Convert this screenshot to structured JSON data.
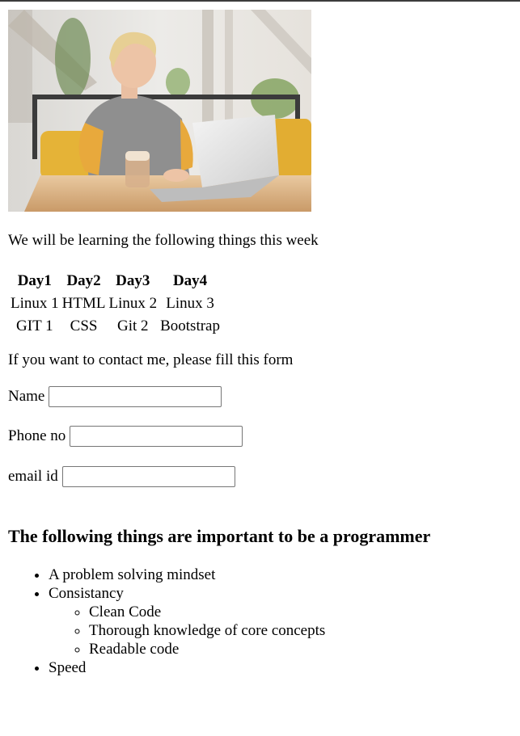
{
  "intro_text": "We will be learning the following things this week",
  "schedule": {
    "headers": [
      "Day1",
      "Day2",
      "Day3",
      "Day4"
    ],
    "rows": [
      [
        "Linux 1",
        "HTML",
        "Linux 2",
        "Linux 3"
      ],
      [
        "GIT 1",
        "CSS",
        "Git 2",
        "Bootstrap"
      ]
    ]
  },
  "contact_text": "If you want to contact me, please fill this form",
  "form": {
    "name_label": "Name",
    "phone_label": "Phone no",
    "email_label": "email id"
  },
  "heading": "The following things are important to be a programmer",
  "list": {
    "item1": "A problem solving mindset",
    "item2": "Consistancy",
    "sub1": "Clean Code",
    "sub2": "Thorough knowledge of core concepts",
    "sub3": "Readable code",
    "item3": "Speed"
  }
}
